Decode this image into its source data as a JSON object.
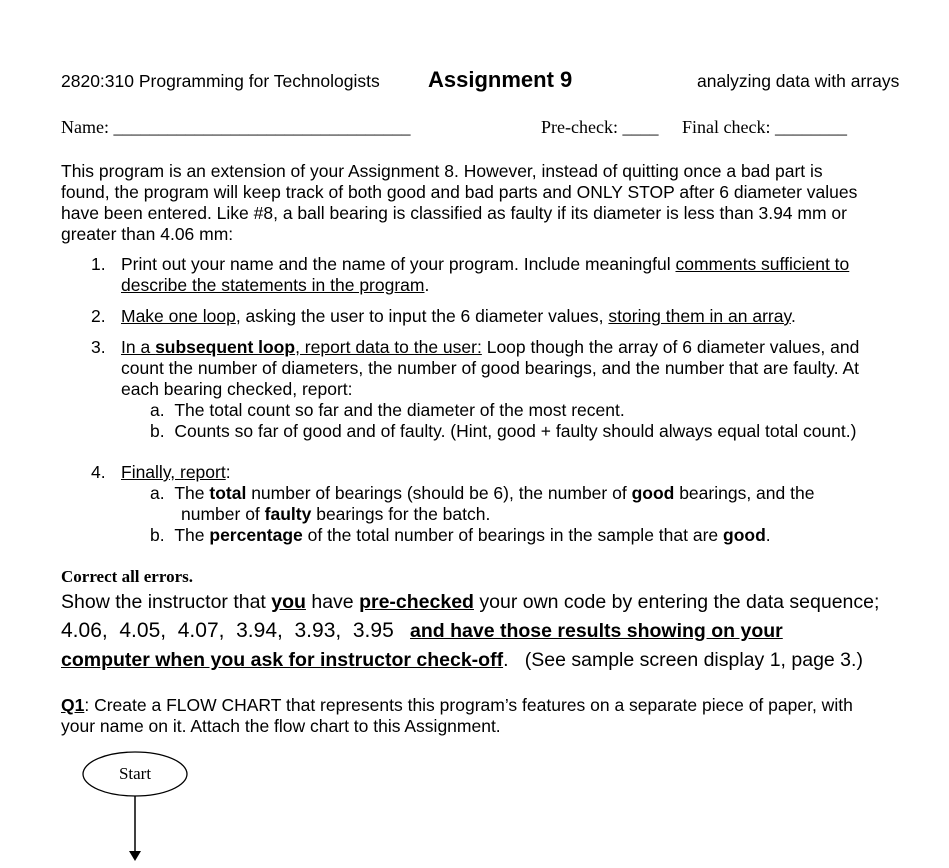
{
  "header": {
    "course": "2820:310 Programming for Technologists",
    "title": "Assignment 9",
    "subtitle": "analyzing data with arrays"
  },
  "form": {
    "name_label": "Name:",
    "name_blank": "_________________________________",
    "precheck_label": "Pre-check:",
    "precheck_blank": "____",
    "finalcheck_label": "Final check:",
    "finalcheck_blank": "________"
  },
  "intro": [
    "This program is an extension of your Assignment 8.  However, instead of quitting once a bad part is",
    "found, the program will keep track of both good and bad parts and ONLY STOP after 6 diameter values",
    "have been entered.  Like #8, a ball bearing is classified as faulty if its diameter is less than 3.94 mm or",
    "greater than 4.06 mm:"
  ],
  "items": {
    "i1": {
      "num": "1.",
      "line1_a": "Print out your name and the name of your program.  Include meaningful ",
      "line1_u": "comments sufficient to",
      "line2_u": "describe the statements in the program",
      "line2_b": "."
    },
    "i2": {
      "num": "2.",
      "u1": "Make one loop",
      "t1": ", asking the user to input the 6 diameter values, ",
      "u2": "storing them in an array",
      "t2": "."
    },
    "i3": {
      "num": "3.",
      "u_a": "In a ",
      "u_b": "subsequent loop",
      "u_c": ", report data to the user:",
      "t1": "  Loop though the array of 6 diameter values, and",
      "line2": "count the number of diameters, the number of good bearings, and the number that are faulty.  At",
      "line3": "each bearing checked, report:",
      "a_label": "a.",
      "a_text": "The total count so far and the diameter of the most recent.",
      "b_label": "b.",
      "b_text": "Counts so far of good and of faulty.  (Hint, good + faulty should always equal total count.)"
    },
    "i4": {
      "num": "4.",
      "u": "Finally, report",
      "t": ":",
      "a_label": "a.",
      "a_1": "The ",
      "a_2": "total",
      "a_3": " number of bearings (should be 6), the number of ",
      "a_4": "good",
      "a_5": " bearings, and the",
      "a_6": "number of ",
      "a_7": "faulty",
      "a_8": " bearings for the batch.",
      "b_label": "b.",
      "b_1": "The ",
      "b_2": "percentage",
      "b_3": " of the total number of bearings in the sample that are ",
      "b_4": "good",
      "b_5": "."
    }
  },
  "correct": "Correct all errors.",
  "show": {
    "s1": "Show the instructor that ",
    "s2": "you",
    "s3": " have ",
    "s4": "pre-checked",
    "s5": " your own code by entering the data sequence;",
    "data_sequence": "4.06,  4.05,  4.07,  3.94,  3.93,  3.95",
    "bold1": "and have those results showing on your",
    "bold2": "computer when you ask for instructor check-off",
    "tail": ".   (See sample screen display 1, page 3.)"
  },
  "q1": {
    "label": "Q1",
    "line1": ":  Create a FLOW CHART that represents this program’s features on a separate piece of paper, with",
    "line2": "your name on it.  Attach the flow chart to this Assignment."
  },
  "flowchart": {
    "start_label": "Start"
  }
}
